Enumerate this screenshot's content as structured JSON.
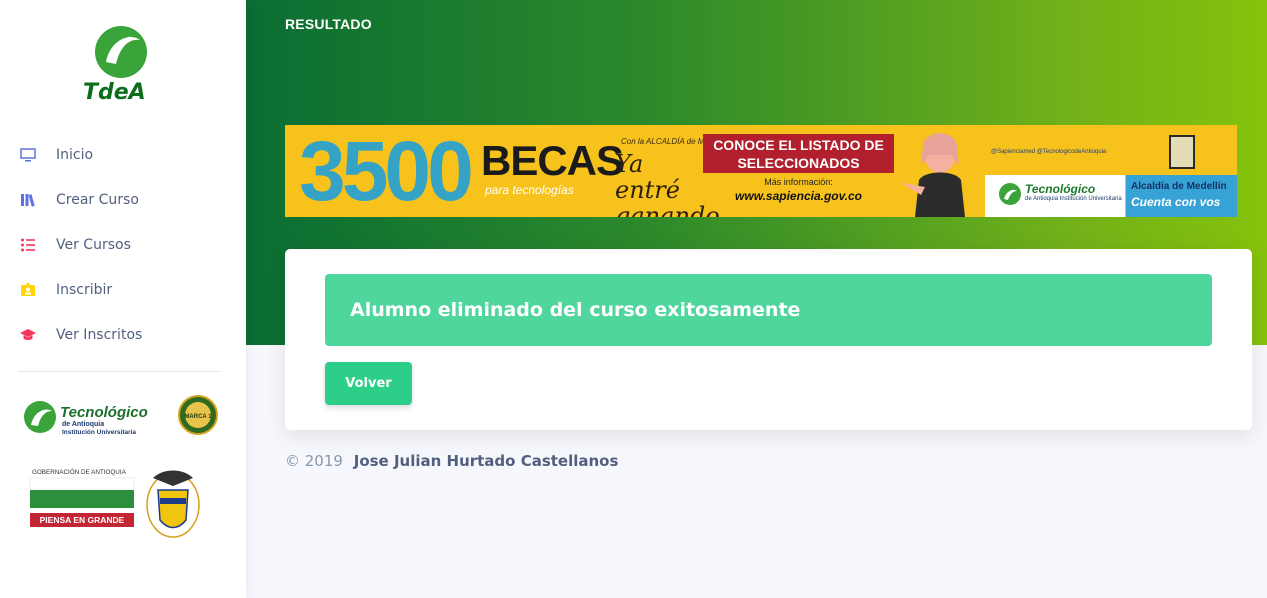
{
  "sidebar": {
    "brand": "TdeA",
    "items": [
      {
        "label": "Inicio",
        "icon": "monitor-icon",
        "color": "#5e72e4"
      },
      {
        "label": "Crear Curso",
        "icon": "books-icon",
        "color": "#5e72e4"
      },
      {
        "label": "Ver Cursos",
        "icon": "list-icon",
        "color": "#f5365c"
      },
      {
        "label": "Inscribir",
        "icon": "badge-icon",
        "color": "#ffd600"
      },
      {
        "label": "Ver Inscritos",
        "icon": "graduation-cap-icon",
        "color": "#f5365c"
      }
    ],
    "partner_logos": {
      "tecnologico_title": "Tecnológico",
      "tecnologico_sub1": "de Antioquia",
      "tecnologico_sub2": "Institución Universitaria",
      "marca_badge": "MARCA 1",
      "gobernacion": "GOBERNACIÓN DE ANTIOQUIA",
      "piensa": "PIENSA EN GRANDE"
    }
  },
  "header": {
    "title": "RESULTADO"
  },
  "banner": {
    "number": "3500",
    "becas": "BECAS",
    "becas_sub": "para tecnologías",
    "ya_prefix": "Con la ALCALDÍA de MEDELLÍN",
    "ya_main": "Ya entré ganando",
    "cta": "CONOCE EL LISTADO DE SELECCIONADOS",
    "info": "Más información:",
    "url": "www.sapiencia.gov.co",
    "social": "@Sapienciamed   @TecnologicodeAntioquia",
    "tec_title": "Tecnológico",
    "tec_sub": "de Antioquia Institución Universitaria",
    "alcaldia": "Alcaldía de Medellín",
    "alcaldia_slogan": "Cuenta con vos"
  },
  "card": {
    "alert_message": "Alumno eliminado del curso exitosamente",
    "back_button": "Volver"
  },
  "footer": {
    "copyright": "© 2019",
    "author": "Jose Julian Hurtado Castellanos"
  },
  "colors": {
    "accent_green": "#2dce89",
    "alert_green": "#4fd69c",
    "header_gradient_start": "#0a6d33",
    "header_gradient_end": "#86c20c"
  }
}
